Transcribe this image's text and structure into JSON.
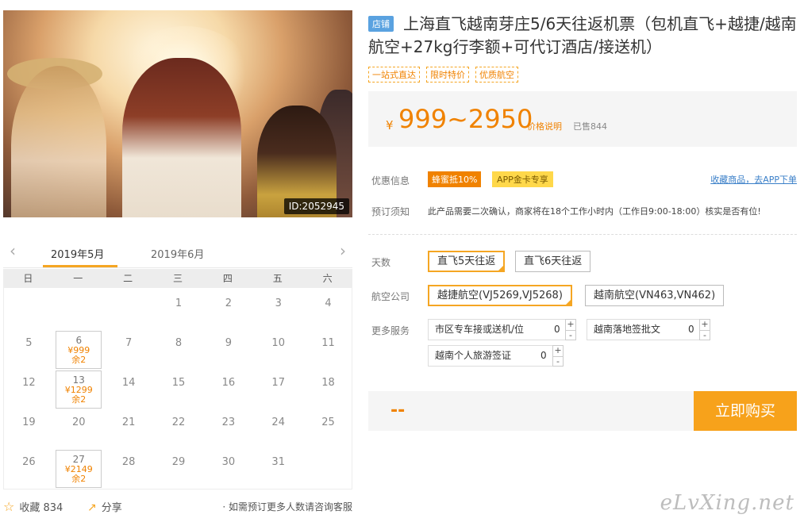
{
  "hero": {
    "image_id_badge": "ID:2052945"
  },
  "calendar": {
    "prev_icon": "‹",
    "next_icon": "›",
    "tabs": [
      "2019年5月",
      "2019年6月"
    ],
    "weekdays": [
      "日",
      "一",
      "二",
      "三",
      "四",
      "五",
      "六"
    ],
    "rows": [
      [
        null,
        null,
        null,
        {
          "d": "1"
        },
        {
          "d": "2"
        },
        {
          "d": "3"
        },
        {
          "d": "4"
        }
      ],
      [
        {
          "d": "5"
        },
        {
          "d": "6",
          "price": "¥999",
          "stock": "余2"
        },
        {
          "d": "7"
        },
        {
          "d": "8"
        },
        {
          "d": "9"
        },
        {
          "d": "10"
        },
        {
          "d": "11"
        }
      ],
      [
        {
          "d": "12"
        },
        {
          "d": "13",
          "price": "¥1299",
          "stock": "余2"
        },
        {
          "d": "14"
        },
        {
          "d": "15"
        },
        {
          "d": "16"
        },
        {
          "d": "17"
        },
        {
          "d": "18"
        }
      ],
      [
        {
          "d": "19"
        },
        {
          "d": "20"
        },
        {
          "d": "21"
        },
        {
          "d": "22"
        },
        {
          "d": "23"
        },
        {
          "d": "24"
        },
        {
          "d": "25"
        }
      ],
      [
        {
          "d": "26"
        },
        {
          "d": "27",
          "price": "¥2149",
          "stock": "余2"
        },
        {
          "d": "28"
        },
        {
          "d": "29"
        },
        {
          "d": "30"
        },
        {
          "d": "31"
        },
        null
      ]
    ]
  },
  "bottom": {
    "fav_label": "收藏 834",
    "share_label": "分享",
    "note": "· 如需预订更多人数请咨询客服"
  },
  "product": {
    "shop_tag": "店铺",
    "title": "上海直飞越南芽庄5/6天往返机票（包机直飞+越捷/越南航空+27kg行李额+可代订酒店/接送机）",
    "tags": [
      "一站式直达",
      "限时特价",
      "优质航空"
    ]
  },
  "price": {
    "currency": "¥",
    "range": "999~2950",
    "explain": "价格说明",
    "sold": "已售844"
  },
  "promo": {
    "label": "优惠信息",
    "badge1": "蜂蜜抵10%",
    "badge2": "APP金卡专享",
    "fav_link": "收藏商品，去APP下单"
  },
  "booking": {
    "label": "预订须知",
    "text": "此产品需要二次确认，商家将在18个工作小时内（工作日9:00-18:00）核实是否有位!"
  },
  "options": {
    "days_label": "天数",
    "days": [
      "直飞5天往返",
      "直飞6天往返"
    ],
    "airline_label": "航空公司",
    "airlines": [
      "越捷航空(VJ5269,VJ5268)",
      "越南航空(VN463,VN462)"
    ],
    "services_label": "更多服务",
    "services": [
      {
        "name": "市区专车接或送机/位",
        "qty": "0"
      },
      {
        "name": "越南落地签批文",
        "qty": "0"
      },
      {
        "name": "越南个人旅游签证",
        "qty": "0"
      }
    ],
    "plus": "+",
    "minus": "-"
  },
  "buy": {
    "total": "--",
    "button": "立即购买"
  },
  "watermark": "eLvXing.net"
}
